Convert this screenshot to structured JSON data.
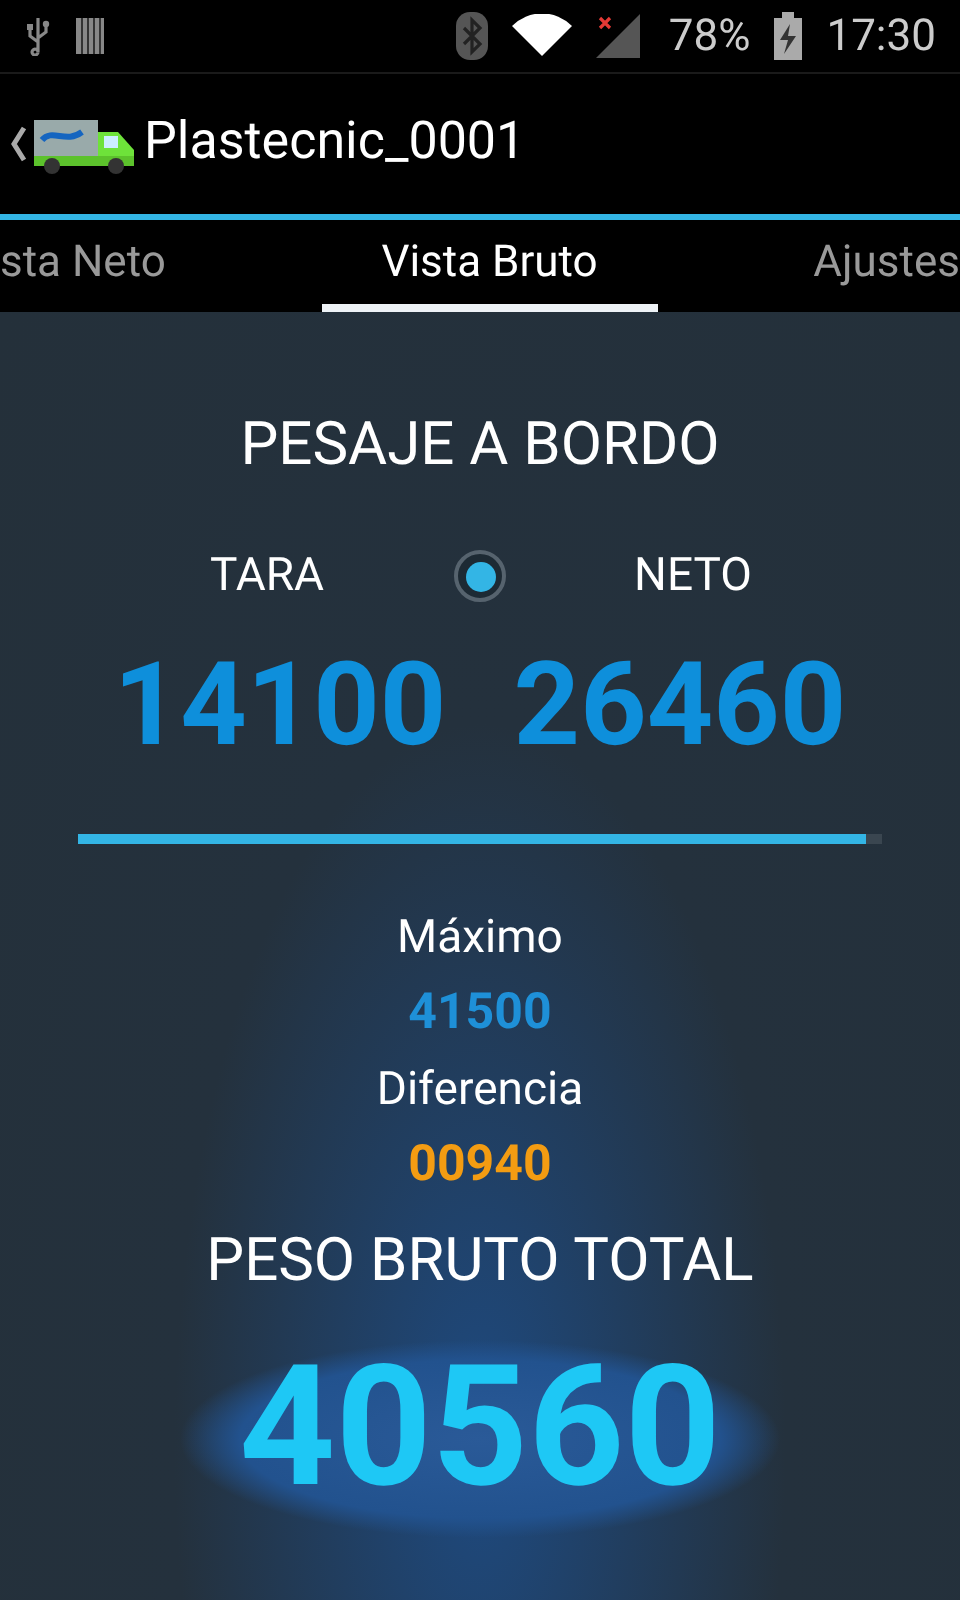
{
  "status_bar": {
    "battery": "78%",
    "time": "17:30"
  },
  "action_bar": {
    "title": "Plastecnic_0001"
  },
  "tabs": [
    {
      "label": "sta Neto",
      "selected": false
    },
    {
      "label": "Vista Bruto",
      "selected": true
    },
    {
      "label": "Ajustes",
      "selected": false
    }
  ],
  "panel": {
    "title": "PESAJE A BORDO",
    "left": {
      "label": "TARA",
      "value": "14100"
    },
    "toggle": {
      "selected": true
    },
    "right": {
      "label": "NETO",
      "value": "26460"
    },
    "bar": {
      "level": 0.98
    },
    "stats": [
      {
        "label": "Máximo",
        "value": "41500",
        "color": "#1e90d8"
      },
      {
        "label": "Diferencia",
        "value": "00940",
        "color": "#f39c12"
      }
    ],
    "total": {
      "label": "PESO BRUTO TOTAL",
      "value": "40560"
    }
  }
}
